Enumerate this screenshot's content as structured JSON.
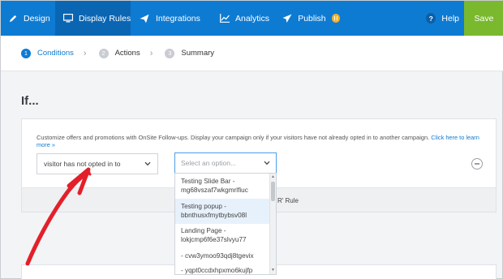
{
  "nav": {
    "items": [
      {
        "label": "Design",
        "icon": "pencil-icon"
      },
      {
        "label": "Display Rules",
        "icon": "monitor-icon",
        "active": true
      },
      {
        "label": "Integrations",
        "icon": "paper-plane-icon"
      },
      {
        "label": "Analytics",
        "icon": "line-chart-icon"
      },
      {
        "label": "Publish",
        "icon": "send-icon",
        "badge": "pause-icon"
      }
    ],
    "help_label": "Help",
    "save_label": "Save",
    "colors": {
      "nav_bg": "#0e7bd3",
      "active_bg": "#0a66b3",
      "save_bg": "#7ab82e",
      "badge": "#f5b323"
    }
  },
  "steps": [
    {
      "num": "1",
      "label": "Conditions",
      "active": true
    },
    {
      "num": "2",
      "label": "Actions"
    },
    {
      "num": "3",
      "label": "Summary"
    }
  ],
  "main": {
    "heading": "If...",
    "description": "Customize offers and promotions with OnSite Follow-ups. Display your campaign only if your visitors have not already opted in to another campaign. ",
    "description_link": "Click here to learn more »",
    "condition_value": "visitor has not opted in to",
    "or_rule_label": "R' Rule"
  },
  "dropdown": {
    "placeholder": "Select an option...",
    "options": [
      {
        "line1": "Testing Slide Bar -",
        "line2": "mg68vszaf7wkgmrlfiuc"
      },
      {
        "line1": "Testing popup -",
        "line2": "bbnthusxfmytbybsv08l",
        "highlighted": true
      },
      {
        "line1": "Landing Page -",
        "line2": "lokjcmp6f6e37slvyu77"
      },
      {
        "line1": "- cvw3ymoo93qdj8tgevix",
        "line2": ""
      },
      {
        "line1": "- yqpt0ccdxhpxmo6kujfp",
        "line2": ""
      }
    ]
  },
  "annotation": {
    "color": "#e3202a"
  }
}
